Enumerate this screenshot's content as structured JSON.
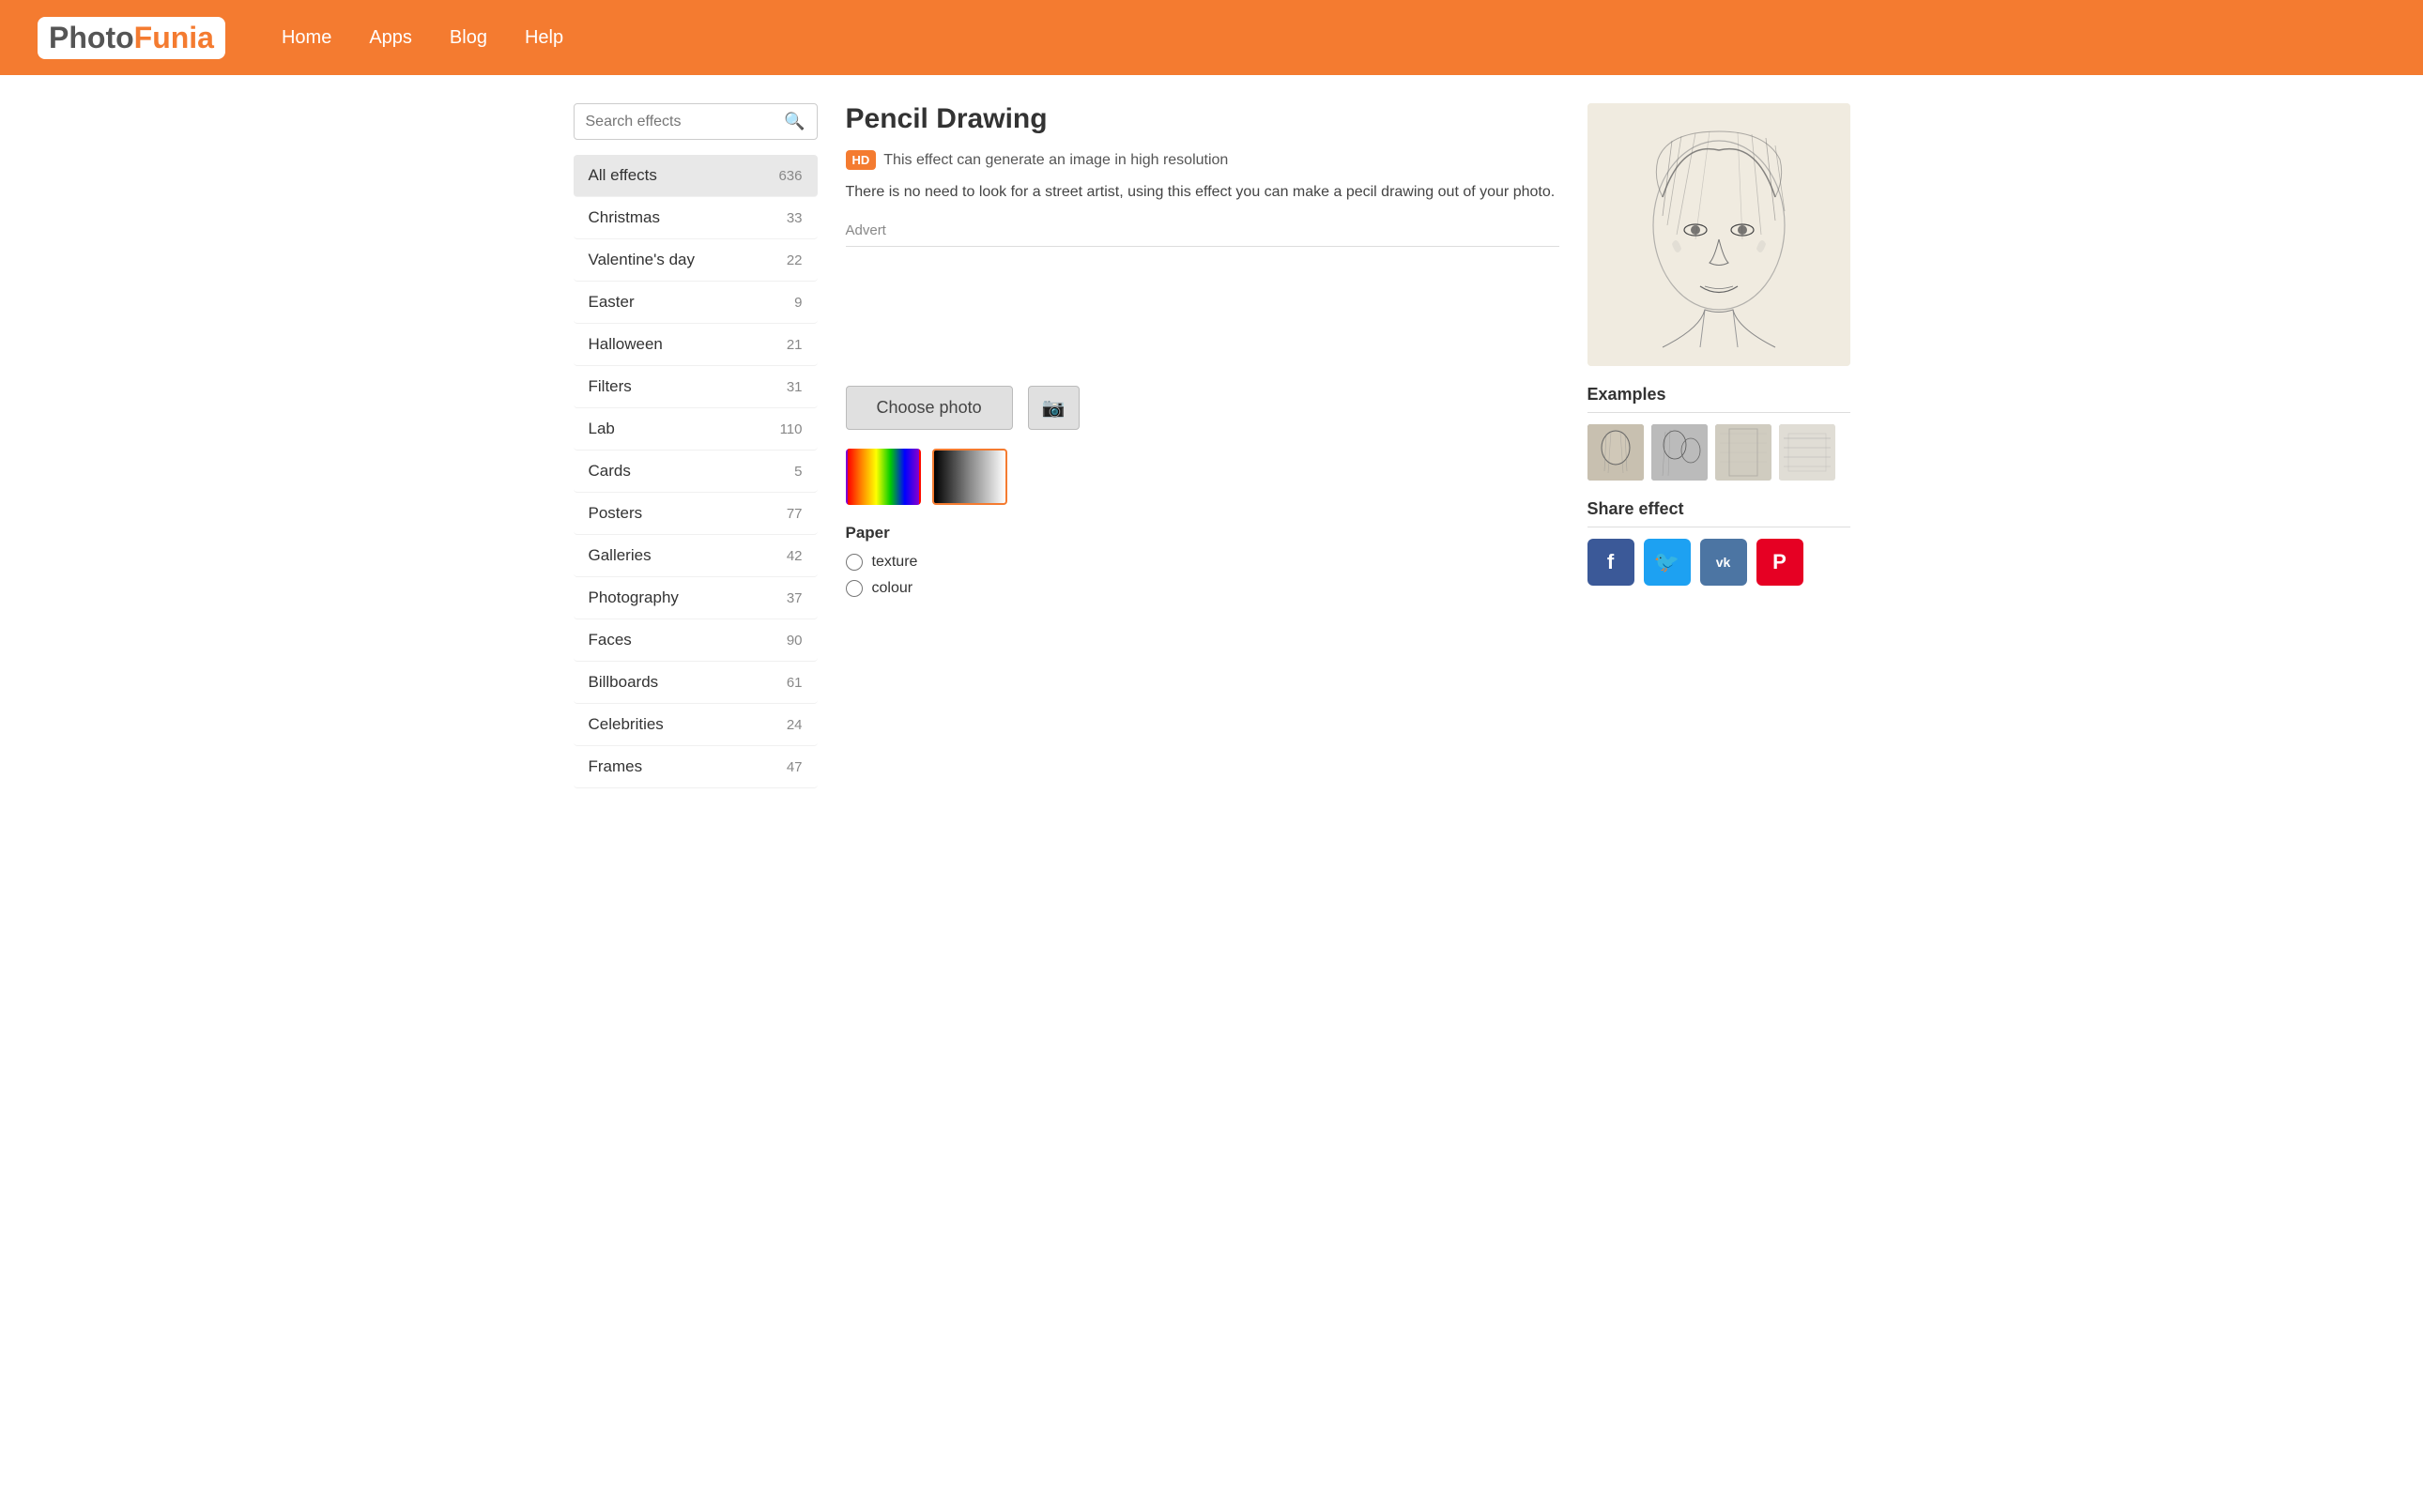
{
  "header": {
    "logo_photo": "Photo",
    "logo_funia": "Funia",
    "nav": [
      {
        "id": "home",
        "label": "Home"
      },
      {
        "id": "apps",
        "label": "Apps"
      },
      {
        "id": "blog",
        "label": "Blog"
      },
      {
        "id": "help",
        "label": "Help"
      }
    ]
  },
  "sidebar": {
    "search_placeholder": "Search effects",
    "items": [
      {
        "id": "all-effects",
        "label": "All effects",
        "count": "636",
        "active": true
      },
      {
        "id": "christmas",
        "label": "Christmas",
        "count": "33",
        "active": false
      },
      {
        "id": "valentines",
        "label": "Valentine's day",
        "count": "22",
        "active": false
      },
      {
        "id": "easter",
        "label": "Easter",
        "count": "9",
        "active": false
      },
      {
        "id": "halloween",
        "label": "Halloween",
        "count": "21",
        "active": false
      },
      {
        "id": "filters",
        "label": "Filters",
        "count": "31",
        "active": false
      },
      {
        "id": "lab",
        "label": "Lab",
        "count": "110",
        "active": false
      },
      {
        "id": "cards",
        "label": "Cards",
        "count": "5",
        "active": false
      },
      {
        "id": "posters",
        "label": "Posters",
        "count": "77",
        "active": false
      },
      {
        "id": "galleries",
        "label": "Galleries",
        "count": "42",
        "active": false
      },
      {
        "id": "photography",
        "label": "Photography",
        "count": "37",
        "active": false
      },
      {
        "id": "faces",
        "label": "Faces",
        "count": "90",
        "active": false
      },
      {
        "id": "billboards",
        "label": "Billboards",
        "count": "61",
        "active": false
      },
      {
        "id": "celebrities",
        "label": "Celebrities",
        "count": "24",
        "active": false
      },
      {
        "id": "frames",
        "label": "Frames",
        "count": "47",
        "active": false
      }
    ]
  },
  "effect": {
    "title": "Pencil Drawing",
    "hd_badge": "HD",
    "hd_description": "This effect can generate an image in high resolution",
    "description": "There is no need to look for a street artist, using this effect you can make a pecil drawing out of your photo.",
    "advert_label": "Advert",
    "choose_photo_label": "Choose photo",
    "camera_icon": "📷",
    "paper_label": "Paper",
    "paper_options": [
      {
        "id": "texture",
        "label": "texture"
      },
      {
        "id": "colour",
        "label": "colour"
      }
    ]
  },
  "right_panel": {
    "examples_title": "Examples",
    "share_title": "Share effect",
    "share_buttons": [
      {
        "id": "facebook",
        "icon": "f",
        "label": "Facebook"
      },
      {
        "id": "twitter",
        "icon": "t",
        "label": "Twitter"
      },
      {
        "id": "vk",
        "icon": "vk",
        "label": "VK"
      },
      {
        "id": "pinterest",
        "icon": "p",
        "label": "Pinterest"
      }
    ]
  }
}
